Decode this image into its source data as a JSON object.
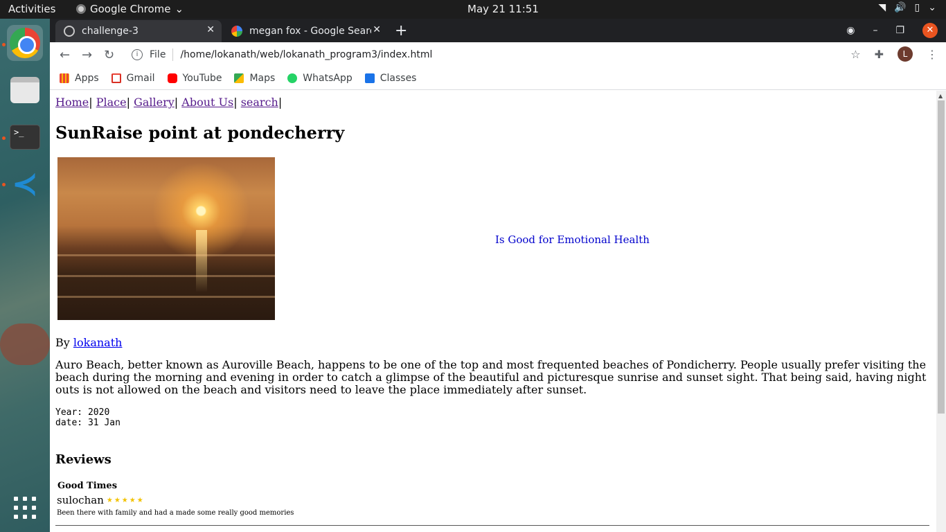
{
  "system": {
    "activities": "Activities",
    "app_name": "Google Chrome",
    "clock": "May 21  11:51"
  },
  "browser": {
    "tabs": [
      {
        "label": "challenge-3",
        "active": true
      },
      {
        "label": "megan fox - Google Search",
        "active": false
      }
    ],
    "omnibox": {
      "scheme": "File",
      "url": "/home/lokanath/web/lokanath_program3/index.html"
    },
    "profile_initial": "L",
    "bookmarks": [
      {
        "label": "Apps",
        "icon": "apps-grid-icon"
      },
      {
        "label": "Gmail",
        "icon": "gmail-icon"
      },
      {
        "label": "YouTube",
        "icon": "youtube-icon"
      },
      {
        "label": "Maps",
        "icon": "maps-icon"
      },
      {
        "label": "WhatsApp",
        "icon": "whatsapp-icon"
      },
      {
        "label": "Classes",
        "icon": "classes-icon"
      }
    ]
  },
  "page": {
    "nav": [
      "Home",
      "Place",
      "Gallery",
      "About Us",
      "search"
    ],
    "title": "SunRaise point at pondecherry",
    "caption": "Is Good for Emotional Health",
    "by_prefix": "By",
    "author": "lokanath",
    "paragraph": "Auro Beach, better known as Auroville Beach, happens to be one of the top and most frequented beaches of Pondicherry. People usually prefer visiting the beach during the morning and evening in order to catch a glimpse of the beautiful and picturesque sunrise and sunset sight. That being said, having night outs is not allowed on the beach and visitors need to leave the place immediately after sunset.",
    "meta_year": "Year: 2020",
    "meta_date": "date: 31 Jan",
    "reviews_heading": "Reviews",
    "review": {
      "title": "Good Times",
      "user": "sulochan",
      "stars": "★★★★★",
      "text": "Been there with family and had a made some really good memories"
    }
  },
  "colors": {
    "link_visited": "#551a8b",
    "link": "#0000ee",
    "accent": "#e95420"
  }
}
